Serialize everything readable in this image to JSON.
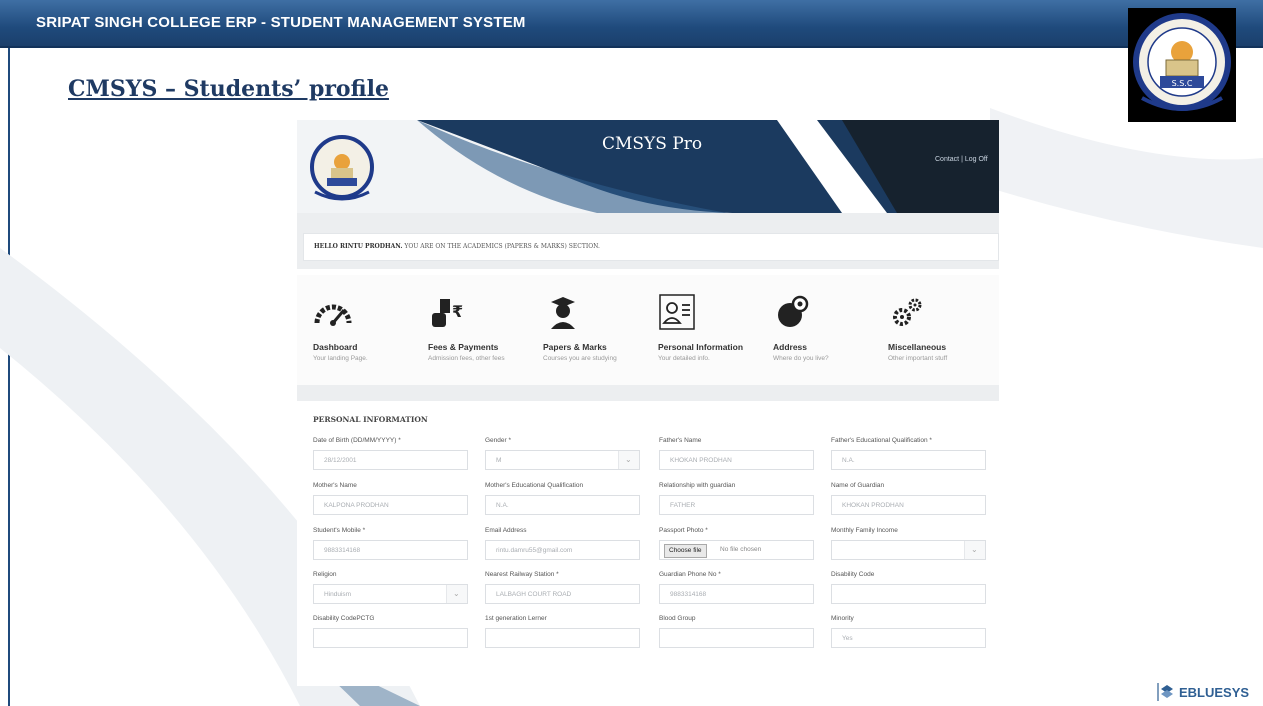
{
  "header": {
    "title": "SRIPAT SINGH COLLEGE ERP  -  STUDENT MANAGEMENT SYSTEM",
    "seal_text": "S.S.C"
  },
  "slide": {
    "title": "CMSYS – Students’ profile"
  },
  "app": {
    "title": "CMSYS Pro",
    "links": [
      "Contact",
      "Log Off"
    ],
    "greeting_name": "HELLO RINTU PRODHAN.",
    "greeting_text": " YOU ARE ON THE ACADEMICS (PAPERS & MARKS) SECTION.",
    "menu": [
      {
        "label": "Dashboard",
        "sub": "Your landing Page.",
        "icon": "speedometer-icon"
      },
      {
        "label": "Fees & Payments",
        "sub": "Admission fees, other fees",
        "icon": "money-hand-icon"
      },
      {
        "label": "Papers & Marks",
        "sub": "Courses you are studying",
        "icon": "graduate-icon"
      },
      {
        "label": "Personal Information",
        "sub": "Your detailed info.",
        "icon": "id-card-icon"
      },
      {
        "label": "Address",
        "sub": "Where do you live?",
        "icon": "globe-pin-icon"
      },
      {
        "label": "Miscellaneous",
        "sub": "Other important stuff",
        "icon": "gears-icon"
      }
    ]
  },
  "form": {
    "section_title": "PERSONAL INFORMATION",
    "fields": [
      {
        "label": "Date of Birth (DD/MM/YYYY) *",
        "value": "28/12/2001",
        "type": "text"
      },
      {
        "label": "Gender *",
        "value": "M",
        "type": "select"
      },
      {
        "label": "Father's Name",
        "value": "KHOKAN PRODHAN",
        "type": "text"
      },
      {
        "label": "Father's Educational Qualification *",
        "value": "N.A.",
        "type": "text"
      },
      {
        "label": "Mother's Name",
        "value": "KALPONA PRODHAN",
        "type": "text"
      },
      {
        "label": "Mother's Educational Qualification",
        "value": "N.A.",
        "type": "text"
      },
      {
        "label": "Relationship with guardian",
        "value": "FATHER",
        "type": "text"
      },
      {
        "label": "Name of Guardian",
        "value": "KHOKAN PRODHAN",
        "type": "text"
      },
      {
        "label": "Student's Mobile *",
        "value": "9883314168",
        "type": "text"
      },
      {
        "label": "Email Address",
        "value": "rintu.damru55@gmail.com",
        "type": "text"
      },
      {
        "label": "Passport Photo *",
        "value": "",
        "type": "file"
      },
      {
        "label": "Monthly Family Income",
        "value": "",
        "type": "select"
      },
      {
        "label": "Religion",
        "value": "Hinduism",
        "type": "select"
      },
      {
        "label": "Nearest Railway Station *",
        "value": "LALBAGH COURT ROAD",
        "type": "text"
      },
      {
        "label": "Guardian Phone No *",
        "value": "9883314168",
        "type": "text"
      },
      {
        "label": "Disability Code",
        "value": "",
        "type": "text"
      },
      {
        "label": "Disability CodePCTG",
        "value": "",
        "type": "text"
      },
      {
        "label": "1st generation Lerner",
        "value": "",
        "type": "text"
      },
      {
        "label": "Blood Group",
        "value": "",
        "type": "text"
      },
      {
        "label": "Minority",
        "value": "Yes",
        "type": "text"
      }
    ],
    "file_button": "Choose file",
    "file_status": "No file chosen"
  },
  "footer": {
    "brand": "EBLUESYS"
  }
}
